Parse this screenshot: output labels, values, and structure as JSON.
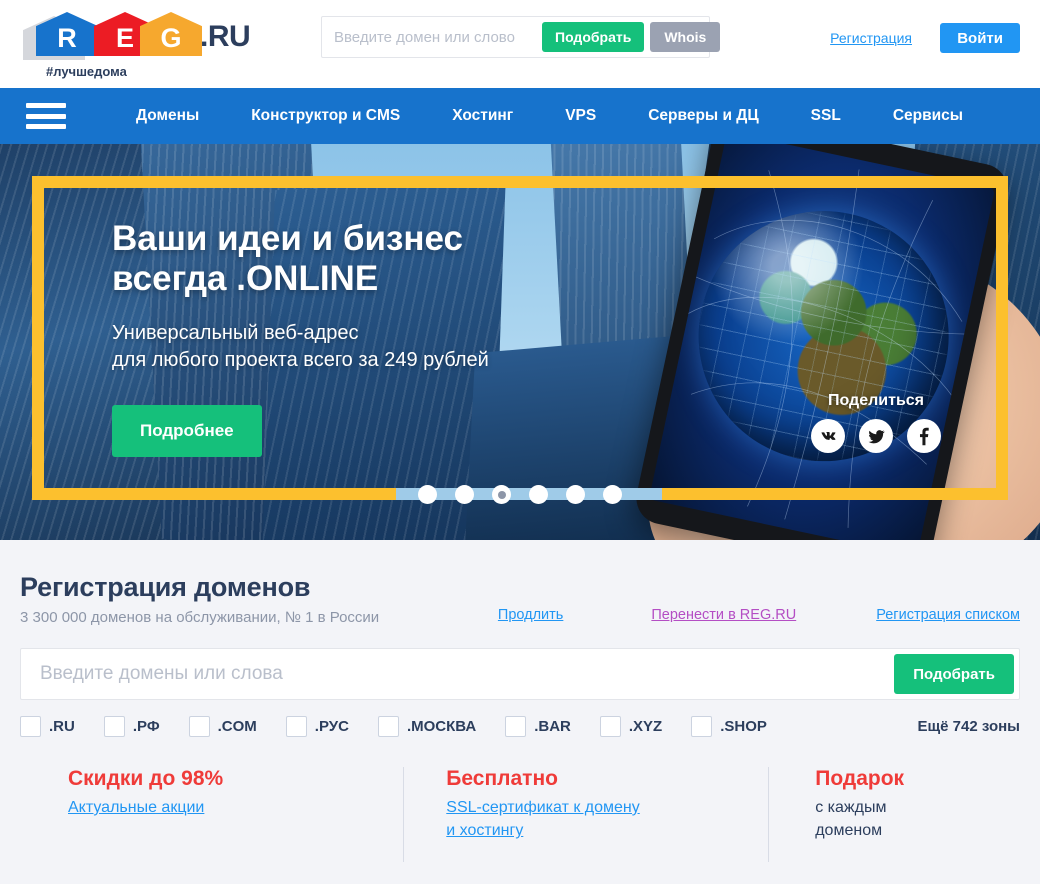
{
  "header": {
    "logo": {
      "letters": [
        "R",
        "E",
        "G"
      ],
      "suffix": ".RU",
      "tagline": "#лучшедома"
    },
    "search": {
      "placeholder": "Введите домен или слово",
      "value": "",
      "pick_label": "Подобрать",
      "whois_label": "Whois"
    },
    "register_link": "Регистрация",
    "login_button": "Войти"
  },
  "nav": {
    "menu_icon": "hamburger-icon",
    "items": [
      "Домены",
      "Конструктор и CMS",
      "Хостинг",
      "VPS",
      "Серверы и ДЦ",
      "SSL",
      "Сервисы"
    ]
  },
  "banner": {
    "heading_line1": "Ваши идеи и бизнес",
    "heading_line2": "всегда .ONLINE",
    "sub_line1": "Универсальный веб-адрес",
    "sub_line2": "для любого проекта всего за 249 рублей",
    "cta": "Подробнее",
    "share_title": "Поделиться",
    "share_icons": [
      "vk-icon",
      "twitter-icon",
      "facebook-icon"
    ],
    "dots_total": 6,
    "dot_active_index": 2,
    "frame_color": "#fcc02e",
    "cta_color": "#15c07b"
  },
  "domains": {
    "title": "Регистрация доменов",
    "subtitle": "3 300 000 доменов на обслуживании, № 1 в России",
    "links": [
      {
        "label": "Продлить",
        "color": "#2196f3"
      },
      {
        "label": "Перенести в REG.RU",
        "color": "#b44ec4"
      },
      {
        "label": "Регистрация списком",
        "color": "#2196f3"
      }
    ],
    "search": {
      "placeholder": "Введите домены или слова",
      "value": "",
      "button": "Подобрать"
    },
    "zones": [
      {
        "label": ".RU",
        "checked": false
      },
      {
        "label": ".РФ",
        "checked": false
      },
      {
        "label": ".COM",
        "checked": false
      },
      {
        "label": ".РУС",
        "checked": false
      },
      {
        "label": ".МОСКВА",
        "checked": false
      },
      {
        "label": ".BAR",
        "checked": false
      },
      {
        "label": ".XYZ",
        "checked": false
      },
      {
        "label": ".SHOP",
        "checked": false
      }
    ],
    "more_zones": "Ещё 742 зоны"
  },
  "promos": [
    {
      "title": "Скидки до 98%",
      "link": "Актуальные акции",
      "text_line1": "",
      "text_line2": ""
    },
    {
      "title": "Бесплатно",
      "link_line1": "SSL-сертификат к домену",
      "link_line2": "и хостингу"
    },
    {
      "title": "Подарок",
      "text_line1": "с каждым",
      "text_line2": "доменом"
    }
  ]
}
